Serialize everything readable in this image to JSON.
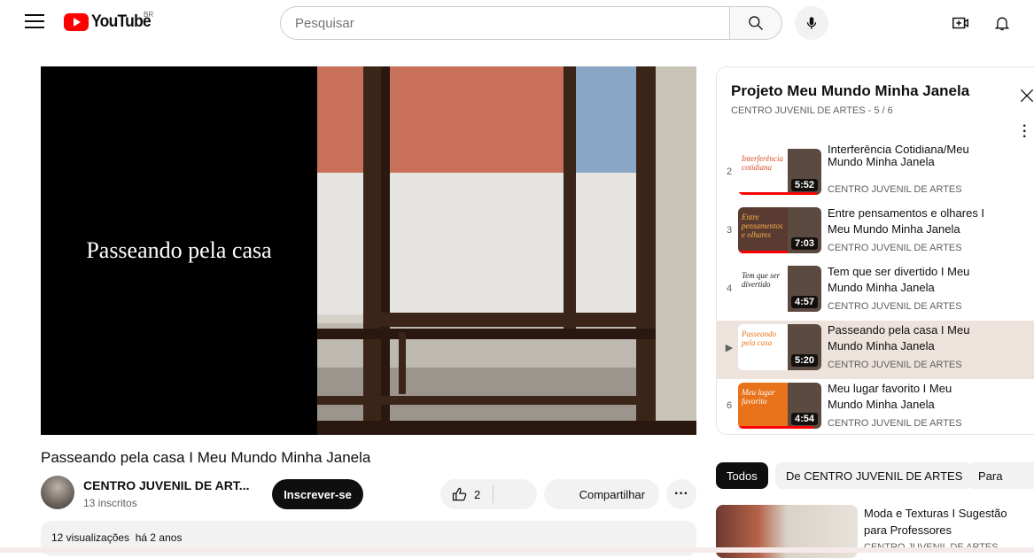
{
  "header": {
    "logo_text": "YouTube",
    "country_code": "BR",
    "search_placeholder": "Pesquisar",
    "icons": [
      "menu-icon",
      "search-icon",
      "mic-icon",
      "create-icon",
      "bell-icon"
    ]
  },
  "player": {
    "overlay_text": "Passeando pela casa"
  },
  "video": {
    "title": "Passeando pela casa I Meu Mundo Minha Janela",
    "channel": "CENTRO JUVENIL DE ART...",
    "subscribers": "13 inscritos",
    "subscribe_label": "Inscrever-se",
    "likes": "2",
    "share_label": "Compartilhar",
    "more_label": "···",
    "views": "12 visualizações",
    "age": "há 2 anos"
  },
  "playlist": {
    "title": "Projeto Meu Mundo Minha Janela",
    "subtitle": "CENTRO JUVENIL DE ARTES - 5 / 6",
    "items": [
      {
        "num": "2",
        "title": "Interferência Cotidiana/Meu Mundo Minha Janela",
        "partial_title": "Interferência Cotidiana/Meu",
        "line2": "Mundo Minha Janela",
        "channel": "CENTRO JUVENIL DE ARTES",
        "duration": "5:52",
        "thumb_text": "Interferência cotidiana",
        "thumb_color": "#ffffff",
        "text_color": "#d9481f",
        "progress": 0.95
      },
      {
        "num": "3",
        "line1": "Entre pensamentos e olhares I",
        "line2": "Meu Mundo Minha Janela",
        "channel": "CENTRO JUVENIL DE ARTES",
        "duration": "7:03",
        "thumb_text": "Entre pensamentos e olhares",
        "thumb_color": "#5a3b31",
        "text_color": "#f5b04a",
        "progress": 0.6
      },
      {
        "num": "4",
        "line1": "Tem que ser divertido I Meu",
        "line2": "Mundo Minha Janela",
        "channel": "CENTRO JUVENIL DE ARTES",
        "duration": "4:57",
        "thumb_text": "Tem que ser divertido",
        "thumb_color": "#ffffff",
        "text_color": "#1a1a1a",
        "progress": 0.0
      },
      {
        "num": "▶",
        "line1": "Passeando pela casa I Meu",
        "line2": "Mundo Minha Janela",
        "channel": "CENTRO JUVENIL DE ARTES",
        "duration": "5:20",
        "thumb_text": "Passeando pela casa",
        "thumb_color": "#ffffff",
        "text_color": "#e8731a",
        "progress": 0.0,
        "active": true
      },
      {
        "num": "6",
        "line1": "Meu lugar favorito I Meu",
        "line2": "Mundo Minha Janela",
        "channel": "CENTRO JUVENIL DE ARTES",
        "duration": "4:54",
        "thumb_text": "Meu lugar favorito",
        "thumb_color": "#e8731a",
        "text_color": "#ffffff",
        "progress": 0.9
      }
    ]
  },
  "chips": [
    "Todos",
    "De CENTRO JUVENIL DE ARTES",
    "Para"
  ],
  "recommendation": {
    "line1": "Moda e Texturas I Sugestão",
    "line2": "para Professores",
    "channel": "CENTRO JUVENIL DE ARTES"
  },
  "colors": {
    "accent": "#ff0000",
    "active_row": "#ede2dc",
    "chip_active": "#0f0f0f"
  }
}
